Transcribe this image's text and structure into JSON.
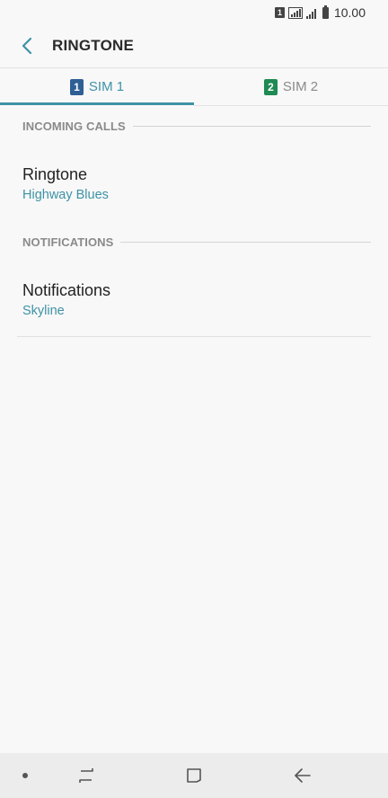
{
  "status_bar": {
    "sim_indicator": "1",
    "time": "10.00",
    "icons": [
      "sim-icon",
      "signal-icon",
      "signal-weak-icon",
      "battery-icon"
    ]
  },
  "header": {
    "title": "RINGTONE",
    "back_icon": "chevron-left-icon"
  },
  "tabs": [
    {
      "badge": "1",
      "label": "SIM 1",
      "active": true,
      "badge_color": "#2e5f95"
    },
    {
      "badge": "2",
      "label": "SIM 2",
      "active": false,
      "badge_color": "#1f8a54"
    }
  ],
  "sections": [
    {
      "label": "INCOMING CALLS",
      "item": {
        "title": "Ringtone",
        "value": "Highway Blues"
      }
    },
    {
      "label": "NOTIFICATIONS",
      "item": {
        "title": "Notifications",
        "value": "Skyline"
      }
    }
  ],
  "nav_bar": {
    "icons": [
      "dot-icon",
      "recent-apps-icon",
      "home-icon",
      "back-arrow-icon"
    ]
  },
  "colors": {
    "accent": "#3d92a6",
    "background": "#f8f8f8"
  }
}
